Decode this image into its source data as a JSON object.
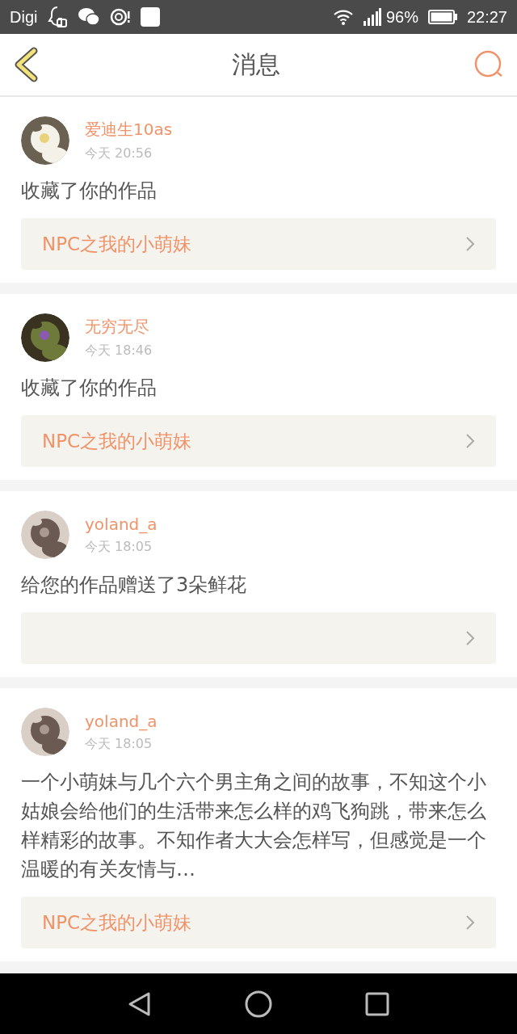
{
  "status_bar": {
    "carrier": "Digi",
    "battery": "96%",
    "time": "22:27"
  },
  "header": {
    "title": "消息"
  },
  "messages": [
    {
      "user": "爱迪生10as",
      "time": "今天 20:56",
      "text": "收藏了你的作品",
      "work": {
        "title": "NPC之我的小萌妹"
      }
    },
    {
      "user": "无穷无尽",
      "time": "今天 18:46",
      "text": "收藏了你的作品",
      "work": {
        "title": "NPC之我的小萌妹"
      }
    },
    {
      "user": "yoland_a",
      "time": "今天 18:05",
      "text": "给您的作品赠送了3朵鲜花"
    },
    {
      "user": "yoland_a",
      "time": "今天 18:05",
      "text": "一个小萌妹与几个六个男主角之间的故事，不知这个小姑娘会给他们的生活带来怎么样的鸡飞狗跳，带来怎么样精彩的故事。不知作者大大会怎样写，但感觉是一个温暖的有关友情与…",
      "work": {
        "title": "NPC之我的小萌妹"
      }
    }
  ]
}
